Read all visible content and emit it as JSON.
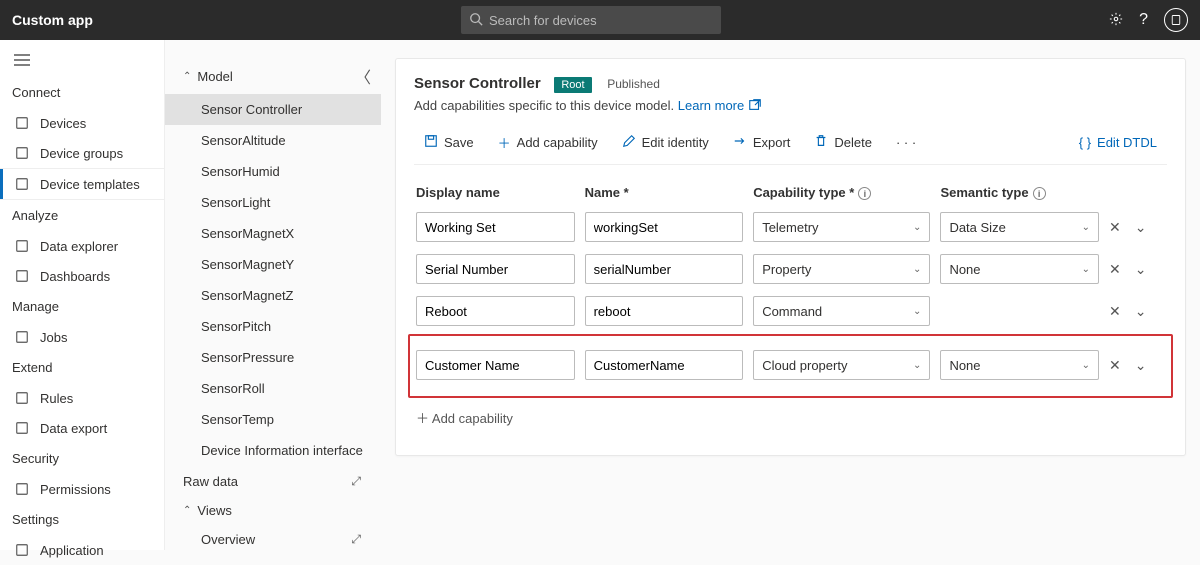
{
  "topbar": {
    "title": "Custom app",
    "search_placeholder": "Search for devices"
  },
  "sidebar": {
    "sections": [
      {
        "label": "Connect",
        "items": [
          {
            "label": "Devices",
            "icon": "devices-icon"
          },
          {
            "label": "Device groups",
            "icon": "groups-icon"
          },
          {
            "label": "Device templates",
            "icon": "templates-icon",
            "active": true
          }
        ]
      },
      {
        "label": "Analyze",
        "items": [
          {
            "label": "Data explorer",
            "icon": "explorer-icon"
          },
          {
            "label": "Dashboards",
            "icon": "dashboard-icon"
          }
        ]
      },
      {
        "label": "Manage",
        "items": [
          {
            "label": "Jobs",
            "icon": "jobs-icon"
          }
        ]
      },
      {
        "label": "Extend",
        "items": [
          {
            "label": "Rules",
            "icon": "rules-icon"
          },
          {
            "label": "Data export",
            "icon": "export-icon"
          }
        ]
      },
      {
        "label": "Security",
        "items": [
          {
            "label": "Permissions",
            "icon": "permissions-icon"
          }
        ]
      },
      {
        "label": "Settings",
        "items": [
          {
            "label": "Application",
            "icon": "application-icon"
          }
        ]
      }
    ]
  },
  "tree": {
    "model_label": "Model",
    "items": [
      "Sensor Controller",
      "SensorAltitude",
      "SensorHumid",
      "SensorLight",
      "SensorMagnetX",
      "SensorMagnetY",
      "SensorMagnetZ",
      "SensorPitch",
      "SensorPressure",
      "SensorRoll",
      "SensorTemp",
      "Device Information interface"
    ],
    "rawdata_label": "Raw data",
    "views_label": "Views",
    "overview_label": "Overview"
  },
  "header": {
    "title": "Sensor Controller",
    "root_badge": "Root",
    "status": "Published",
    "subtitle": "Add capabilities specific to this device model.",
    "learnmore": "Learn more"
  },
  "toolbar": {
    "save": "Save",
    "addcap": "Add capability",
    "editid": "Edit identity",
    "export": "Export",
    "delete": "Delete",
    "editdtdl": "Edit DTDL"
  },
  "columns": {
    "display": "Display name",
    "name": "Name *",
    "captype": "Capability type *",
    "semtype": "Semantic type"
  },
  "rows": [
    {
      "display": "Working Set",
      "name": "workingSet",
      "captype": "Telemetry",
      "semtype": "Data Size",
      "has_semtype": true
    },
    {
      "display": "Serial Number",
      "name": "serialNumber",
      "captype": "Property",
      "semtype": "None",
      "has_semtype": true
    },
    {
      "display": "Reboot",
      "name": "reboot",
      "captype": "Command",
      "semtype": "",
      "has_semtype": false
    },
    {
      "display": "Customer Name",
      "name": "CustomerName",
      "captype": "Cloud property",
      "semtype": "None",
      "has_semtype": true,
      "highlighted": true
    }
  ],
  "addcap_footer": "Add capability"
}
